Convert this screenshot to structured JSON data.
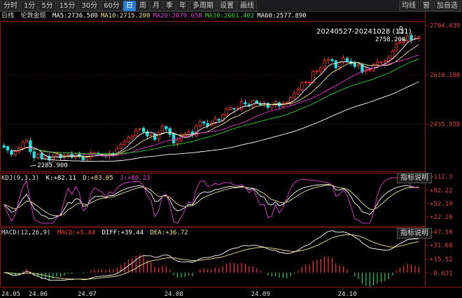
{
  "toolbar": {
    "tabs": [
      {
        "label": "分时",
        "active": false
      },
      {
        "label": "1分",
        "active": false
      },
      {
        "label": "5分",
        "active": false
      },
      {
        "label": "15分",
        "active": false
      },
      {
        "label": "30分",
        "active": false
      },
      {
        "label": "60分",
        "active": false
      },
      {
        "label": "日",
        "active": true
      },
      {
        "label": "周",
        "active": false
      },
      {
        "label": "月",
        "active": false
      },
      {
        "label": "季",
        "active": false
      },
      {
        "label": "年",
        "active": false
      },
      {
        "label": "多周期",
        "active": false
      },
      {
        "label": "设置",
        "active": false
      },
      {
        "label": "画线",
        "active": false
      }
    ],
    "right_buttons": [
      "均线",
      "窗",
      "加自选"
    ]
  },
  "price_panel": {
    "period": "日线",
    "name": "伦敦金现",
    "ma": [
      {
        "label": "MA5:",
        "value": "2736.500",
        "color": "#ffffff"
      },
      {
        "label": "MA10:",
        "value": "2715.200",
        "color": "#f0e68c"
      },
      {
        "label": "MA20:",
        "value": "2679.658",
        "color": "#e040d0"
      },
      {
        "label": "MA30:",
        "value": "2661.402",
        "color": "#33cc33"
      },
      {
        "label": "MA60:",
        "value": "2577.890",
        "color": "#ffffff"
      }
    ],
    "range_label": "20240527-20241028 (111)",
    "high_label": "2758.200",
    "low_label": "2285.900",
    "y_ticks": [
      "2784.439",
      "2610.188",
      "2435.938"
    ]
  },
  "kdj_panel": {
    "title": "KDJ(9,3,3)",
    "k_label": "K:",
    "k": "+82.11",
    "d_label": "D:",
    "d": "+83.05",
    "j_label": "J:",
    "j": "+80.23",
    "help": "指标说明",
    "y_ticks": [
      "+112.3",
      "+82.22",
      "+52.19",
      "+22.16"
    ]
  },
  "macd_panel": {
    "title": "MACD(12,26,9)",
    "macd_label": "MACD:",
    "macd": "+5.44",
    "dif_label": "DIFF:",
    "dif": "+39.44",
    "dea_label": "DEA:",
    "dea": "+36.72",
    "help": "指标说明",
    "y_ticks": [
      "+47.16",
      "+31.68",
      "+15.52",
      "-0.631"
    ]
  },
  "x_axis": [
    "24.05",
    "24.06",
    "24.07",
    "24.08",
    "24.09",
    "24.10"
  ],
  "colors": {
    "up": "#ff3333",
    "down": "#22dddd",
    "axis": "#8a1818",
    "ma5": "#ffffff",
    "ma10": "#f0e68c",
    "ma20": "#e040d0",
    "ma30": "#33cc33",
    "ma60": "#ffffff",
    "k": "#ffffff",
    "d": "#f0e68c",
    "j": "#e040d0"
  },
  "chart_data": {
    "type": "candlestick",
    "title": "伦敦金现 日线",
    "period": "20240527-20241028",
    "bars": 111,
    "ylim": [
      2270,
      2800
    ],
    "closes": [
      2355,
      2345,
      2330,
      2340,
      2352,
      2372,
      2380,
      2340,
      2318,
      2330,
      2315,
      2325,
      2310,
      2322,
      2330,
      2318,
      2325,
      2330,
      2320,
      2330,
      2322,
      2310,
      2320,
      2336,
      2335,
      2330,
      2330,
      2326,
      2334,
      2330,
      2350,
      2365,
      2375,
      2390,
      2395,
      2415,
      2420,
      2410,
      2395,
      2400,
      2382,
      2405,
      2430,
      2420,
      2400,
      2370,
      2380,
      2395,
      2402,
      2410,
      2398,
      2430,
      2445,
      2440,
      2430,
      2440,
      2455,
      2450,
      2470,
      2490,
      2495,
      2490,
      2492,
      2515,
      2508,
      2500,
      2520,
      2510,
      2505,
      2510,
      2495,
      2505,
      2515,
      2500,
      2510,
      2512,
      2530,
      2545,
      2560,
      2583,
      2585,
      2585,
      2622,
      2625,
      2635,
      2660,
      2665,
      2660,
      2635,
      2654,
      2670,
      2658,
      2650,
      2640,
      2645,
      2620,
      2630,
      2628,
      2647,
      2655,
      2655,
      2660,
      2670,
      2694,
      2719,
      2725,
      2732,
      2748,
      2734,
      2740,
      2744
    ],
    "ma5_last": 2736.5,
    "ma10_last": 2715.2,
    "ma20_last": 2679.658,
    "ma30_last": 2661.402,
    "ma60_last": 2577.89,
    "high": 2758.2,
    "low": 2285.9,
    "kdj_last": {
      "k": 82.11,
      "d": 83.05,
      "j": 80.23
    },
    "macd_last": {
      "macd": 5.44,
      "dif": 39.44,
      "dea": 36.72
    }
  }
}
